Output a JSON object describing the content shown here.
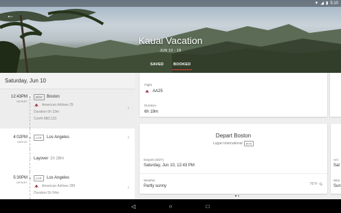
{
  "status_bar": {
    "time": "5:10",
    "icons": [
      "wifi-icon",
      "signal-icon",
      "battery-icon"
    ]
  },
  "hero": {
    "title": "Kauai Vacation",
    "dates": "JUN 10 - 18",
    "tabs": [
      {
        "label": "SAVED",
        "active": false
      },
      {
        "label": "BOOKED",
        "active": true
      }
    ]
  },
  "itinerary": {
    "day": "Saturday, Jun 10",
    "segments": [
      {
        "time": "12:43PM",
        "sub": "DEPART",
        "code": "BOS",
        "city": "Boston",
        "airline": "American Airlines 25",
        "duration": "Duration 6h 19m",
        "conf": "Conf# ABC123"
      },
      {
        "time": "4:02PM",
        "sub": "ARRIVE",
        "code": "LAX",
        "city": "Los Angeles"
      },
      {
        "layover_label": "Layover",
        "layover_duration": "1h 28m"
      },
      {
        "time": "5:30PM",
        "sub": "DEPART",
        "code": "LAX",
        "city": "Los Angeles",
        "airline": "American Airlines 285",
        "duration": "Duration 5h 54m"
      }
    ]
  },
  "flight_card": {
    "flight_label": "Flight",
    "flight_value": "AA25",
    "duration_label": "Duration",
    "duration_value": "6h 19m"
  },
  "depart_card": {
    "title": "Depart Boston",
    "airport": "Logan International",
    "airport_code": "BOS",
    "departs_label": "Departs (EDT)",
    "departs_value": "Saturday, Jun 10, 12:43 PM",
    "weather_label": "Weather",
    "weather_value": "Partly sunny",
    "temp": "76°F"
  },
  "peek_card": {
    "arrive_label": "Arri",
    "arrive_value": "Sat",
    "weather_label": "Wea",
    "weather_value": "Sun"
  },
  "colors": {
    "accent": "#e53935",
    "airline": "#c62828"
  }
}
